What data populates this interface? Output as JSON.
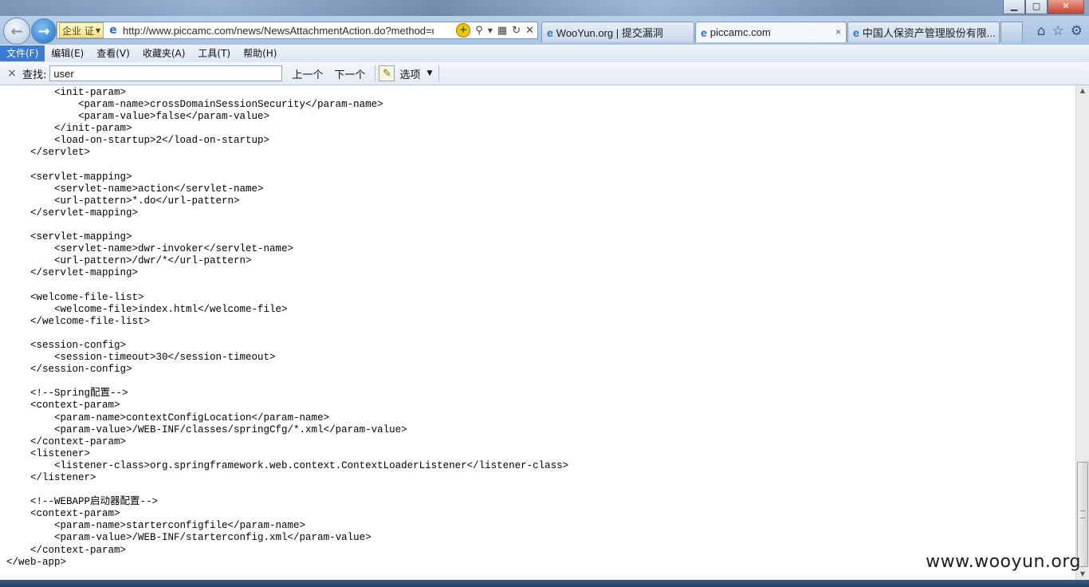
{
  "address_bar": {
    "badge_text": "企业 证",
    "url": "http://www.piccamc.com/news/NewsAttachmentAction.do?method=d"
  },
  "tabs": [
    {
      "label": "WooYun.org | 提交漏洞"
    },
    {
      "label": "piccamc.com",
      "close": "×"
    },
    {
      "label": "中国人保资产管理股份有限..."
    }
  ],
  "window_controls": {
    "minimize": "▁",
    "maximize": "▢",
    "close": "✕"
  },
  "menu": [
    {
      "label": "文件(F)"
    },
    {
      "label": "编辑(E)"
    },
    {
      "label": "查看(V)"
    },
    {
      "label": "收藏夹(A)"
    },
    {
      "label": "工具(T)"
    },
    {
      "label": "帮助(H)"
    }
  ],
  "find_bar": {
    "close": "×",
    "label": "查找:",
    "query": "user",
    "prev": "上一个",
    "next": "下一个",
    "options": "选项"
  },
  "code_lines": [
    "        <init-param>",
    "            <param-name>crossDomainSessionSecurity</param-name>",
    "            <param-value>false</param-value>",
    "        </init-param>",
    "        <load-on-startup>2</load-on-startup>",
    "    </servlet>",
    "",
    "    <servlet-mapping>",
    "        <servlet-name>action</servlet-name>",
    "        <url-pattern>*.do</url-pattern>",
    "    </servlet-mapping>",
    "",
    "    <servlet-mapping>",
    "        <servlet-name>dwr-invoker</servlet-name>",
    "        <url-pattern>/dwr/*</url-pattern>",
    "    </servlet-mapping>",
    "",
    "    <welcome-file-list>",
    "        <welcome-file>index.html</welcome-file>",
    "    </welcome-file-list>",
    "",
    "    <session-config>",
    "        <session-timeout>30</session-timeout>",
    "    </session-config>",
    "",
    "    <!--Spring配置-->",
    "    <context-param>",
    "        <param-name>contextConfigLocation</param-name>",
    "        <param-value>/WEB-INF/classes/springCfg/*.xml</param-value>",
    "    </context-param>",
    "    <listener>",
    "        <listener-class>org.springframework.web.context.ContextLoaderListener</listener-class>",
    "    </listener>",
    "",
    "    <!--WEBAPP启动器配置-->",
    "    <context-param>",
    "        <param-name>starterconfigfile</param-name>",
    "        <param-value>/WEB-INF/starterconfig.xml</param-value>",
    "    </context-param>",
    "</web-app>"
  ],
  "watermark": "www.wooyun.org",
  "colors": {
    "menu_active": "#3b7bd6",
    "tab_icon": "#2a6fd0"
  }
}
